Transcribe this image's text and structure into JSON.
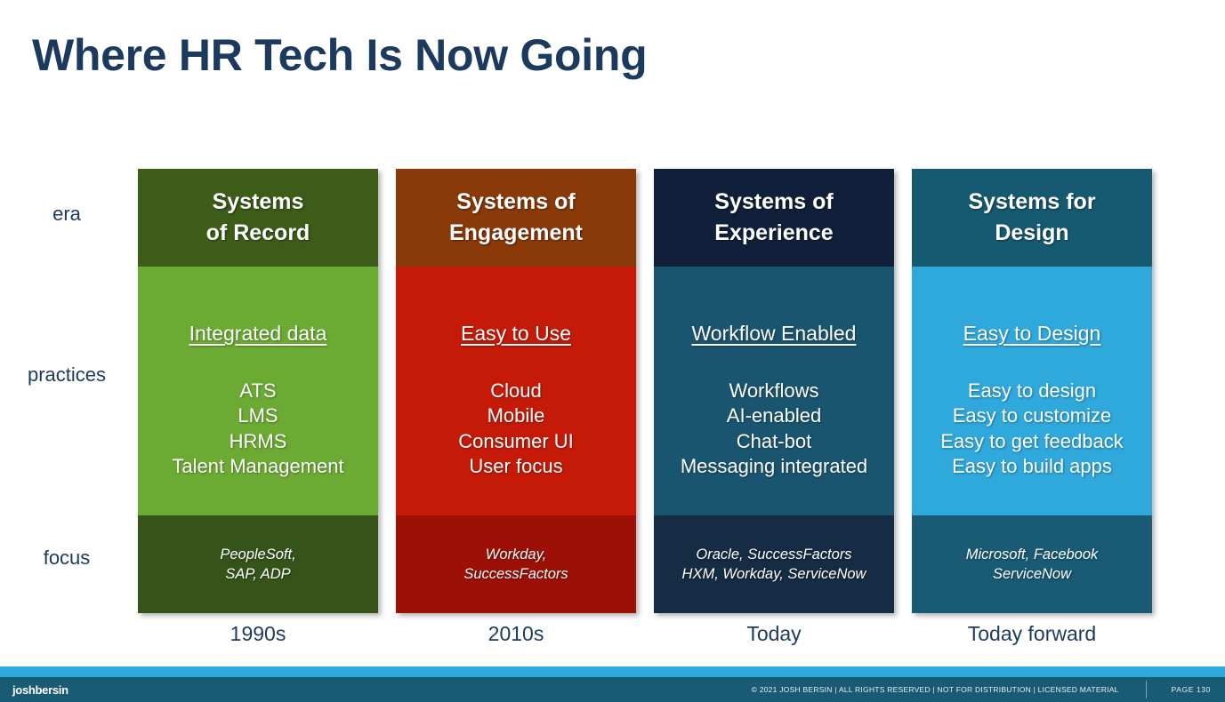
{
  "slide": {
    "title": "Where HR Tech Is Now Going",
    "title_color": "#1b3a5e",
    "background": "#ffffff"
  },
  "row_labels": {
    "era": "era",
    "practices": "practices",
    "focus": "focus"
  },
  "columns": [
    {
      "header": {
        "line1": "Systems",
        "line2": "of Record"
      },
      "header_color": "#3d5c17",
      "body_color": "#6cab33",
      "footer_color": "#36541a",
      "heading": "Integrated data",
      "items": [
        "ATS",
        "LMS",
        "HRMS",
        "Talent Management"
      ],
      "footer": {
        "line1": "PeopleSoft,",
        "line2": "SAP, ADP"
      },
      "timeline": "1990s"
    },
    {
      "header": {
        "line1": "Systems of",
        "line2": "Engagement"
      },
      "header_color": "#8a3908",
      "body_color": "#c61a09",
      "footer_color": "#9c1006",
      "heading": "Easy to Use",
      "items": [
        "Cloud",
        "Mobile",
        "Consumer UI",
        "User focus"
      ],
      "footer": {
        "line1": "Workday,",
        "line2": "SuccessFactors"
      },
      "timeline": "2010s"
    },
    {
      "header": {
        "line1": "Systems of",
        "line2": "Experience"
      },
      "header_color": "#10203a",
      "body_color": "#1a5570",
      "footer_color": "#152c44",
      "heading": "Workflow Enabled",
      "items": [
        "Workflows",
        "AI-enabled",
        "Chat-bot",
        "Messaging integrated"
      ],
      "footer": {
        "line1": "Oracle, SuccessFactors",
        "line2": "HXM, Workday, ServiceNow"
      },
      "timeline": "Today"
    },
    {
      "header": {
        "line1": "Systems for",
        "line2": "Design"
      },
      "header_color": "#155a70",
      "body_color": "#2fa8dc",
      "footer_color": "#195a75",
      "heading": "Easy to Design",
      "items": [
        "Easy to design",
        "Easy to customize",
        "Easy to get feedback",
        "Easy to build apps"
      ],
      "footer": {
        "line1": "Microsoft, Facebook",
        "line2": "ServiceNow"
      },
      "timeline": "Today forward"
    }
  ],
  "footer_bar": {
    "brand": "joshbersin",
    "copyright": "© 2021 JOSH BERSIN | ALL RIGHTS RESERVED | NOT FOR DISTRIBUTION | LICENSED MATERIAL",
    "page": "PAGE  130",
    "stripe_color": "#2fa8dc",
    "bar_color": "#195a75"
  }
}
